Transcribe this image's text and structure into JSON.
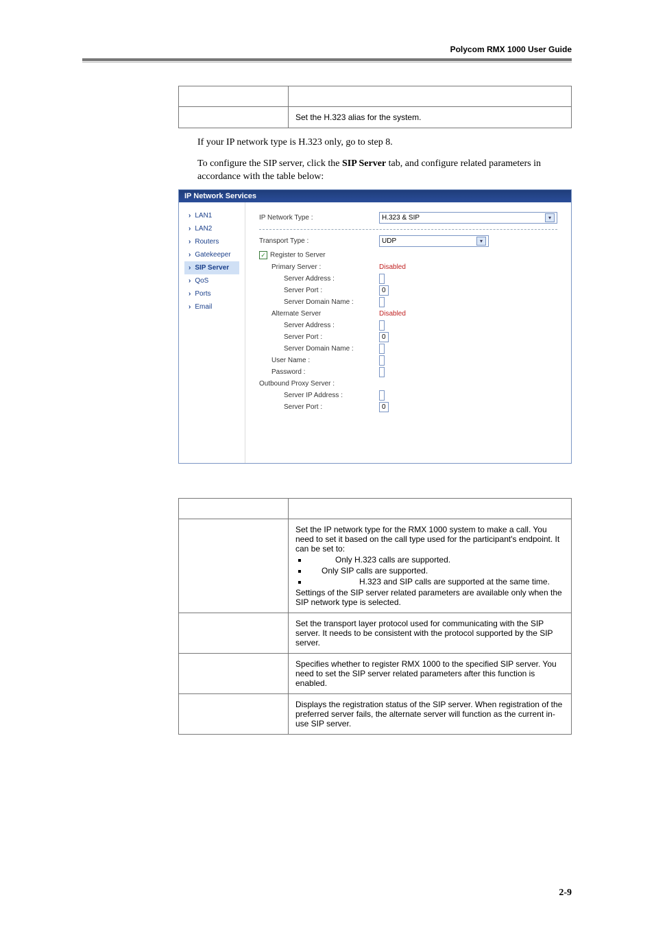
{
  "header": {
    "guide": "Polycom RMX 1000 User Guide"
  },
  "table1": {
    "col1": "",
    "desc": "Set the H.323 alias for the system."
  },
  "paragraphs": {
    "p1": "If your IP network type is H.323 only, go to step 8.",
    "p2a": "To configure the SIP server, click the ",
    "p2b": "SIP Server",
    "p2c": " tab, and configure related parameters in accordance with the table below:"
  },
  "dialog": {
    "title": "IP Network Services",
    "nav": [
      "LAN1",
      "LAN2",
      "Routers",
      "Gatekeeper",
      "SIP Server",
      "QoS",
      "Ports",
      "Email"
    ],
    "form": {
      "ip_network_type_lbl": "IP Network Type :",
      "ip_network_type_val": "H.323 & SIP",
      "transport_type_lbl": "Transport Type :",
      "transport_type_val": "UDP",
      "register_lbl": "Register to Server",
      "primary_server_lbl": "Primary Server :",
      "primary_server_val": "Disabled",
      "server_address_lbl": "Server Address :",
      "server_port_lbl": "Server Port :",
      "server_port_val": "0",
      "server_domain_lbl": "Server Domain Name :",
      "alternate_server_lbl": "Alternate Server",
      "alternate_server_val": "Disabled",
      "alt_server_address_lbl": "Server Address :",
      "alt_server_port_lbl": "Server Port :",
      "alt_server_port_val": "0",
      "alt_server_domain_lbl": "Server Domain Name :",
      "username_lbl": "User Name :",
      "password_lbl": "Password :",
      "outbound_proxy_lbl": "Outbound Proxy Server :",
      "server_ip_lbl": "Server IP Address :",
      "out_server_port_lbl": "Server Port :",
      "out_server_port_val": "0"
    }
  },
  "table2": {
    "rows": [
      {
        "desc": {
          "intro": "Set the IP network type for the RMX 1000 system to make a call. You need to set it based on the call type used for the participant's endpoint. It can be set to:",
          "bullets": [
            "Only H.323 calls are supported.",
            "Only SIP calls are supported.",
            "H.323 and SIP calls are supported at the same time."
          ],
          "outro": "Settings of the SIP server related parameters are available only when the SIP network type is selected."
        }
      },
      {
        "desc_plain": "Set the transport layer protocol used for communicating with the SIP server. It needs to be consistent with the protocol supported by the SIP server."
      },
      {
        "desc_plain": "Specifies whether to register RMX 1000 to the specified SIP server. You need to set the SIP server related parameters after this function is enabled."
      },
      {
        "desc_plain": "Displays the registration status of the SIP server. When registration of the preferred server fails, the alternate server will function as the current in-use SIP server."
      }
    ]
  },
  "page_num": "2-9"
}
